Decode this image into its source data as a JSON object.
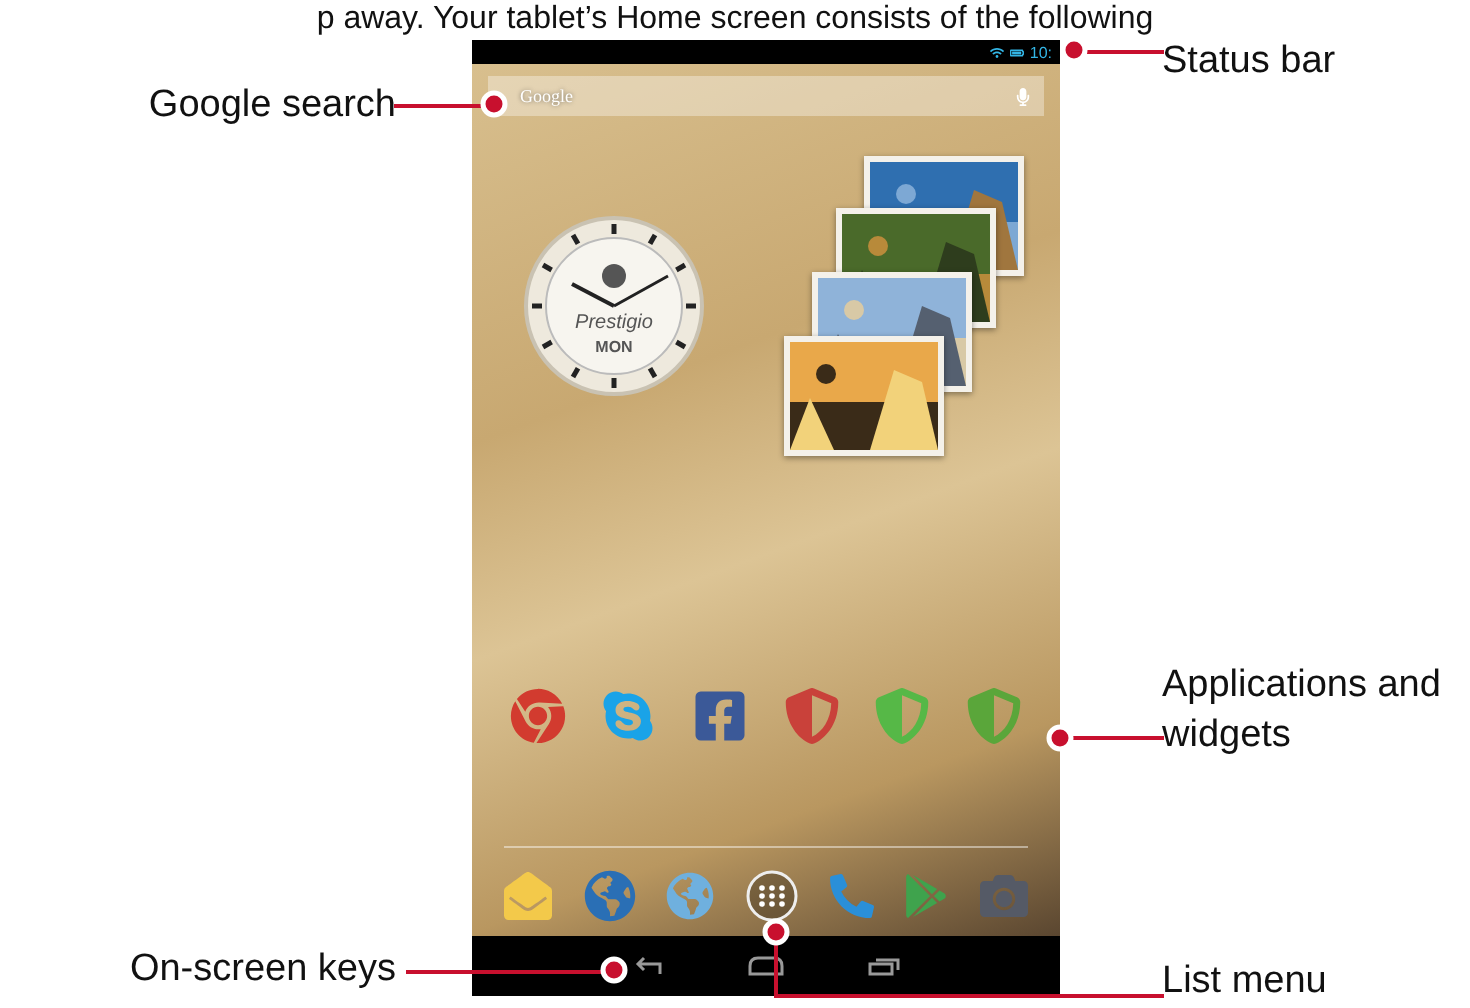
{
  "header_text": "p away. Your tablet’s Home screen consists of the following",
  "left_callouts": [
    {
      "label": "Google search"
    },
    {
      "label": "On-screen keys"
    }
  ],
  "right_callouts": [
    {
      "label": "Status bar"
    },
    {
      "label": "Applications and widgets"
    },
    {
      "label": "List menu"
    }
  ],
  "status_bar": {
    "time": "10:"
  },
  "search": {
    "placeholder": "Google"
  },
  "clock": {
    "brand": "Prestigio",
    "day": "MON"
  }
}
